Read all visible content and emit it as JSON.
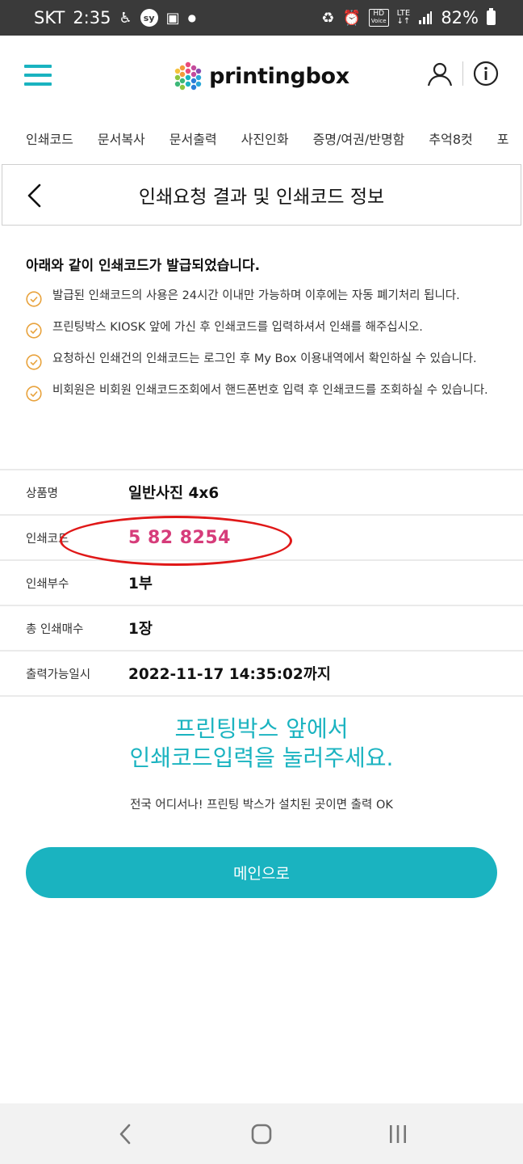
{
  "status_bar": {
    "carrier": "SKT",
    "time": "2:35",
    "sy_badge": "sy",
    "hd_label": "HD",
    "voice_label": "Voice",
    "lte_label": "LTE",
    "battery": "82%"
  },
  "header": {
    "logo_text": "printingbox"
  },
  "category_nav": {
    "items": [
      "인쇄코드",
      "문서복사",
      "문서출력",
      "사진인화",
      "증명/여권/반명함",
      "추억8컷",
      "포"
    ]
  },
  "page": {
    "title": "인쇄요청 결과 및 인쇄코드 정보"
  },
  "notice": {
    "heading": "아래와 같이 인쇄코드가 발급되었습니다.",
    "items": [
      "발급된 인쇄코드의 사용은 24시간 이내만 가능하며 이후에는 자동 폐기처리 됩니다.",
      "프린팅박스 KIOSK 앞에 가신 후 인쇄코드를 입력하셔서 인쇄를 해주십시오.",
      "요청하신 인쇄건의 인쇄코드는 로그인 후 My Box 이용내역에서 확인하실 수 있습니다.",
      "비회원은 비회원 인쇄코드조회에서 핸드폰번호 입력 후 인쇄코드를 조회하실 수 있습니다."
    ]
  },
  "info": {
    "rows": [
      {
        "label": "상품명",
        "value": "일반사진 4x6"
      },
      {
        "label": "인쇄코드",
        "value": "5 82 8254"
      },
      {
        "label": "인쇄부수",
        "value": "1부"
      },
      {
        "label": "총 인쇄매수",
        "value": "1장"
      },
      {
        "label": "출력가능일시",
        "value": "2022-11-17 14:35:02까지"
      }
    ]
  },
  "promo": {
    "line1": "프린팅박스 앞에서",
    "line2": "인쇄코드입력을 눌러주세요.",
    "subtext": "전국 어디서나! 프린팅 박스가 설치된 곳이면 출력 OK"
  },
  "main_button": {
    "label": "메인으로"
  },
  "colors": {
    "accent": "#1ab3c0",
    "code": "#d63c7a",
    "check": "#e8a23c",
    "annotation": "#e01818"
  }
}
